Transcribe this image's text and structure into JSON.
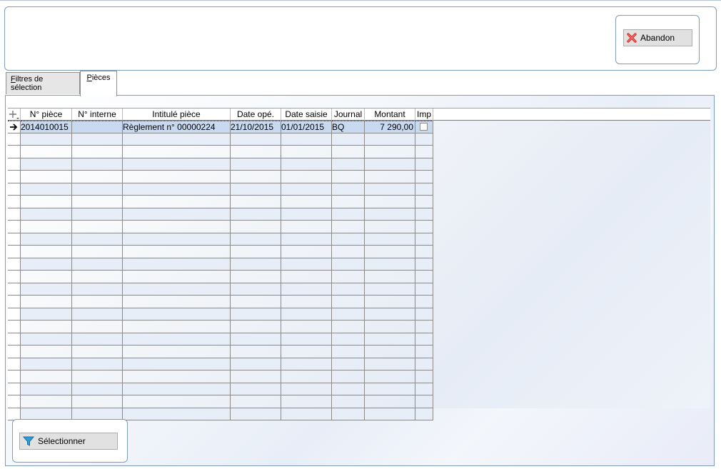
{
  "toolbar": {
    "abandon_label": "Abandon"
  },
  "tabs": [
    {
      "label": "Filtres de sélection",
      "accel": "F",
      "rest": "iltres de sélection"
    },
    {
      "label": "Pièces",
      "accel": "P",
      "rest": "ièces",
      "active": true
    }
  ],
  "grid": {
    "columns": [
      "N° pièce",
      "N° interne",
      "Intitulé pièce",
      "Date opé.",
      "Date saisie",
      "Journal",
      "Montant",
      "Imp"
    ],
    "rows": [
      {
        "num_piece": "2014010015",
        "num_interne": "",
        "intitule": "Règlement n° 00000224",
        "date_ope": "21/10/2015",
        "date_saisie": "01/01/2015",
        "journal": "BQ",
        "montant": "7 290,00",
        "imp": false
      }
    ],
    "empty_row_count": 23
  },
  "footer": {
    "select_label": "Sélectionner"
  },
  "colors": {
    "selected_row": "#c9daf0",
    "alt_row": "#e8eef7",
    "border": "#7f9db9"
  }
}
